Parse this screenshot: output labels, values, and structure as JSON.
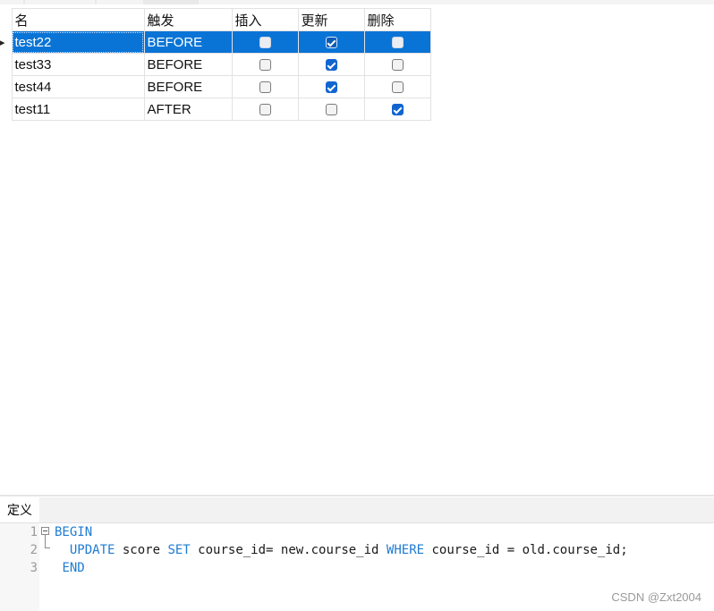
{
  "table": {
    "headers": [
      "名",
      "触发",
      "插入",
      "更新",
      "删除"
    ],
    "rows": [
      {
        "name": "test22",
        "timing": "BEFORE",
        "insert": false,
        "update": true,
        "delete": false,
        "selected": true
      },
      {
        "name": "test33",
        "timing": "BEFORE",
        "insert": false,
        "update": true,
        "delete": false,
        "selected": false
      },
      {
        "name": "test44",
        "timing": "BEFORE",
        "insert": false,
        "update": true,
        "delete": false,
        "selected": false
      },
      {
        "name": "test11",
        "timing": "AFTER",
        "insert": false,
        "update": false,
        "delete": true,
        "selected": false
      }
    ],
    "row_indicator": "▸"
  },
  "definition": {
    "tab_label": "定义",
    "line_numbers": [
      "1",
      "2",
      "3"
    ],
    "code": {
      "line1": {
        "kw": "BEGIN"
      },
      "line2": {
        "kw1": "UPDATE",
        "t1": " score ",
        "kw2": "SET",
        "t2": " course_id= new.course_id ",
        "kw3": "WHERE",
        "t3": " course_id = old.course_id;"
      },
      "line3": {
        "kw": "END"
      }
    }
  },
  "watermark": "CSDN @Zxt2004",
  "colors": {
    "selection": "#0a74d6",
    "keyword": "#1f7bd1",
    "checkbox_checked": "#1265d0"
  }
}
